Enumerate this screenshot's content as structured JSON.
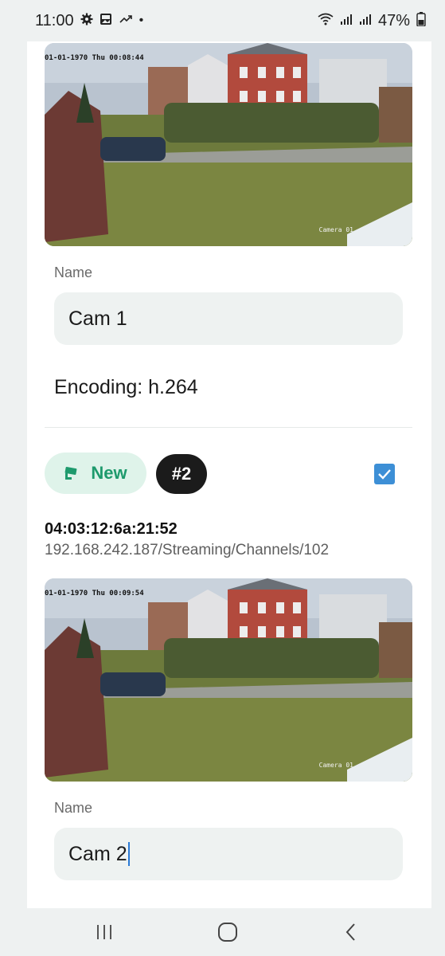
{
  "status_bar": {
    "time": "11:00",
    "icons_left": [
      "gear-icon",
      "image-icon",
      "missed-call-icon",
      "dot"
    ],
    "icons_right": [
      "wifi-icon",
      "signal-icon",
      "signal-icon"
    ],
    "battery": "47%"
  },
  "cameras": [
    {
      "osd_date": "01-01-1970 Thu 00:08:44",
      "osd_camera": "Camera 01",
      "name_label": "Name",
      "name_value": "Cam 1",
      "encoding": "Encoding: h.264"
    },
    {
      "status_chip": "New",
      "index_chip": "#2",
      "selected": true,
      "mac": "04:03:12:6a:21:52",
      "url": "192.168.242.187/Streaming/Channels/102",
      "osd_date": "01-01-1970 Thu 00:09:54",
      "osd_camera": "Camera 01",
      "name_label": "Name",
      "name_value": "Cam 2"
    }
  ],
  "nav_bar": {
    "buttons": [
      "recents-icon",
      "home-icon",
      "back-icon"
    ]
  },
  "colors": {
    "accent_green": "#1e9a6d",
    "chip_green_bg": "#dff3ea",
    "checkbox_blue": "#3d8fd6"
  }
}
